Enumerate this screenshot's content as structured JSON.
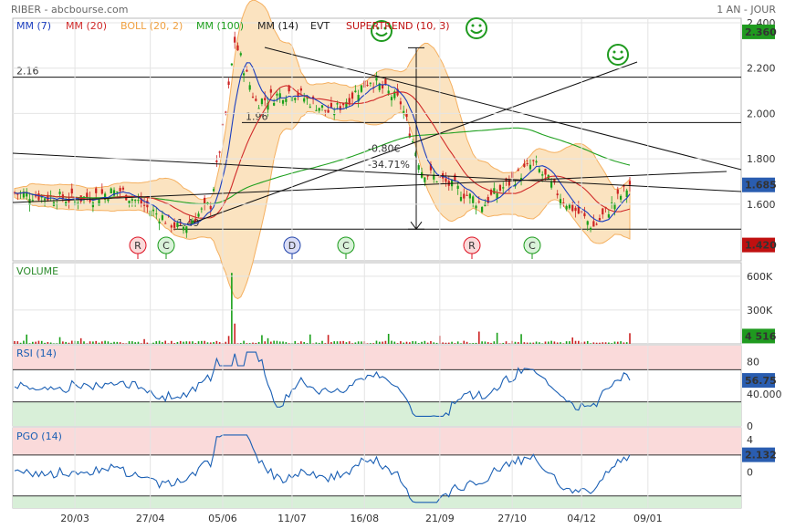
{
  "header": {
    "title": "RIBER - abcbourse.com",
    "period": "1 AN - JOUR"
  },
  "legend": [
    {
      "text": "MM (7)",
      "color": "#1a3dbf"
    },
    {
      "text": "MM (20)",
      "color": "#d02a2a"
    },
    {
      "text": "BOLL (20, 2)",
      "color": "#f0a040"
    },
    {
      "text": "MM (100)",
      "color": "#1fa01f"
    },
    {
      "text": "MM (14)",
      "color": "#222222"
    },
    {
      "text": "EVT",
      "color": "#222222"
    },
    {
      "text": "SUPERTREND (10, 3)",
      "color": "#c01010"
    }
  ],
  "colors": {
    "up": "#1aa01a",
    "down": "#cc2222",
    "ma7": "#1a3dbf",
    "ma20": "#d02a2a",
    "boll": "#f5b060",
    "ma100": "#1fa01f",
    "rsi": "#1a5fb4",
    "price_badge": "#2a5db0",
    "price_badge_green": "#1f9a1f",
    "price_badge_red": "#c01010"
  },
  "chart_data": [
    {
      "type": "line",
      "panel": "price",
      "ylim": [
        1.35,
        2.42
      ],
      "y_ticks": [
        "2.400",
        "2.200",
        "2.000",
        "1.800",
        "1.600"
      ],
      "y_tick_values": [
        2.4,
        2.2,
        2.0,
        1.8,
        1.6
      ],
      "x_ticks": [
        "20/03",
        "27/04",
        "05/06",
        "11/07",
        "16/08",
        "21/09",
        "27/10",
        "04/12",
        "09/01"
      ],
      "series": [
        {
          "name": "MM (7)",
          "color": "#1a3dbf"
        },
        {
          "name": "MM (20)",
          "color": "#d02a2a"
        },
        {
          "name": "BOLL (20, 2)",
          "color": "#f5b060"
        },
        {
          "name": "MM (100)",
          "color": "#1fa01f"
        }
      ],
      "key_closes": {
        "start": 1.65,
        "low_may": 1.49,
        "peak_june": 2.32,
        "july": 2.1,
        "aug": 2.15,
        "sept": 1.75,
        "oct": 1.6,
        "nov": 1.78,
        "dec_low": 1.5,
        "last": 1.685
      },
      "levels": [
        {
          "label": "2.16",
          "value": 2.16
        },
        {
          "label": "1.96",
          "value": 1.96
        },
        {
          "label": "1.49",
          "value": 1.49
        }
      ],
      "measure": {
        "pct": "-34.71%",
        "abs": "-0.80€",
        "from": 2.29,
        "to": 1.49
      },
      "badges": [
        {
          "label": "2.360",
          "value": 2.36,
          "kind": "green"
        },
        {
          "label": "1.685",
          "value": 1.685,
          "kind": "blue"
        },
        {
          "label": "1.420",
          "value": 1.42,
          "kind": "red"
        }
      ],
      "signals": [
        {
          "label": "R",
          "kind": "R"
        },
        {
          "label": "C",
          "kind": "C"
        },
        {
          "label": "D",
          "kind": "D"
        },
        {
          "label": "C",
          "kind": "C"
        },
        {
          "label": "R",
          "kind": "R"
        },
        {
          "label": "C",
          "kind": "C"
        }
      ]
    },
    {
      "type": "bar",
      "panel": "volume",
      "title": "VOLUME",
      "ylim": [
        0,
        720000
      ],
      "y_ticks": [
        "600K",
        "300K"
      ],
      "y_tick_values": [
        600000,
        300000
      ],
      "last_label": "4 516",
      "last_value": 4516,
      "peak_value": 630000
    },
    {
      "type": "line",
      "panel": "rsi",
      "title": "RSI (14)",
      "ylim": [
        0,
        100
      ],
      "y_ticks": [
        "80",
        "40.000",
        "0"
      ],
      "y_tick_values": [
        80,
        40,
        0
      ],
      "bands": {
        "high": 70,
        "low": 30
      },
      "last_label": "56.75",
      "last_value": 56.75
    },
    {
      "type": "line",
      "panel": "pgo",
      "title": "PGO (14)",
      "ylim": [
        -4.5,
        5.5
      ],
      "y_ticks": [
        "4",
        "2",
        "0"
      ],
      "y_tick_values": [
        4,
        2,
        0
      ],
      "bands": {
        "high": 2.1,
        "low": -3
      },
      "last_label": "2.132",
      "last_value": 2.132
    }
  ]
}
